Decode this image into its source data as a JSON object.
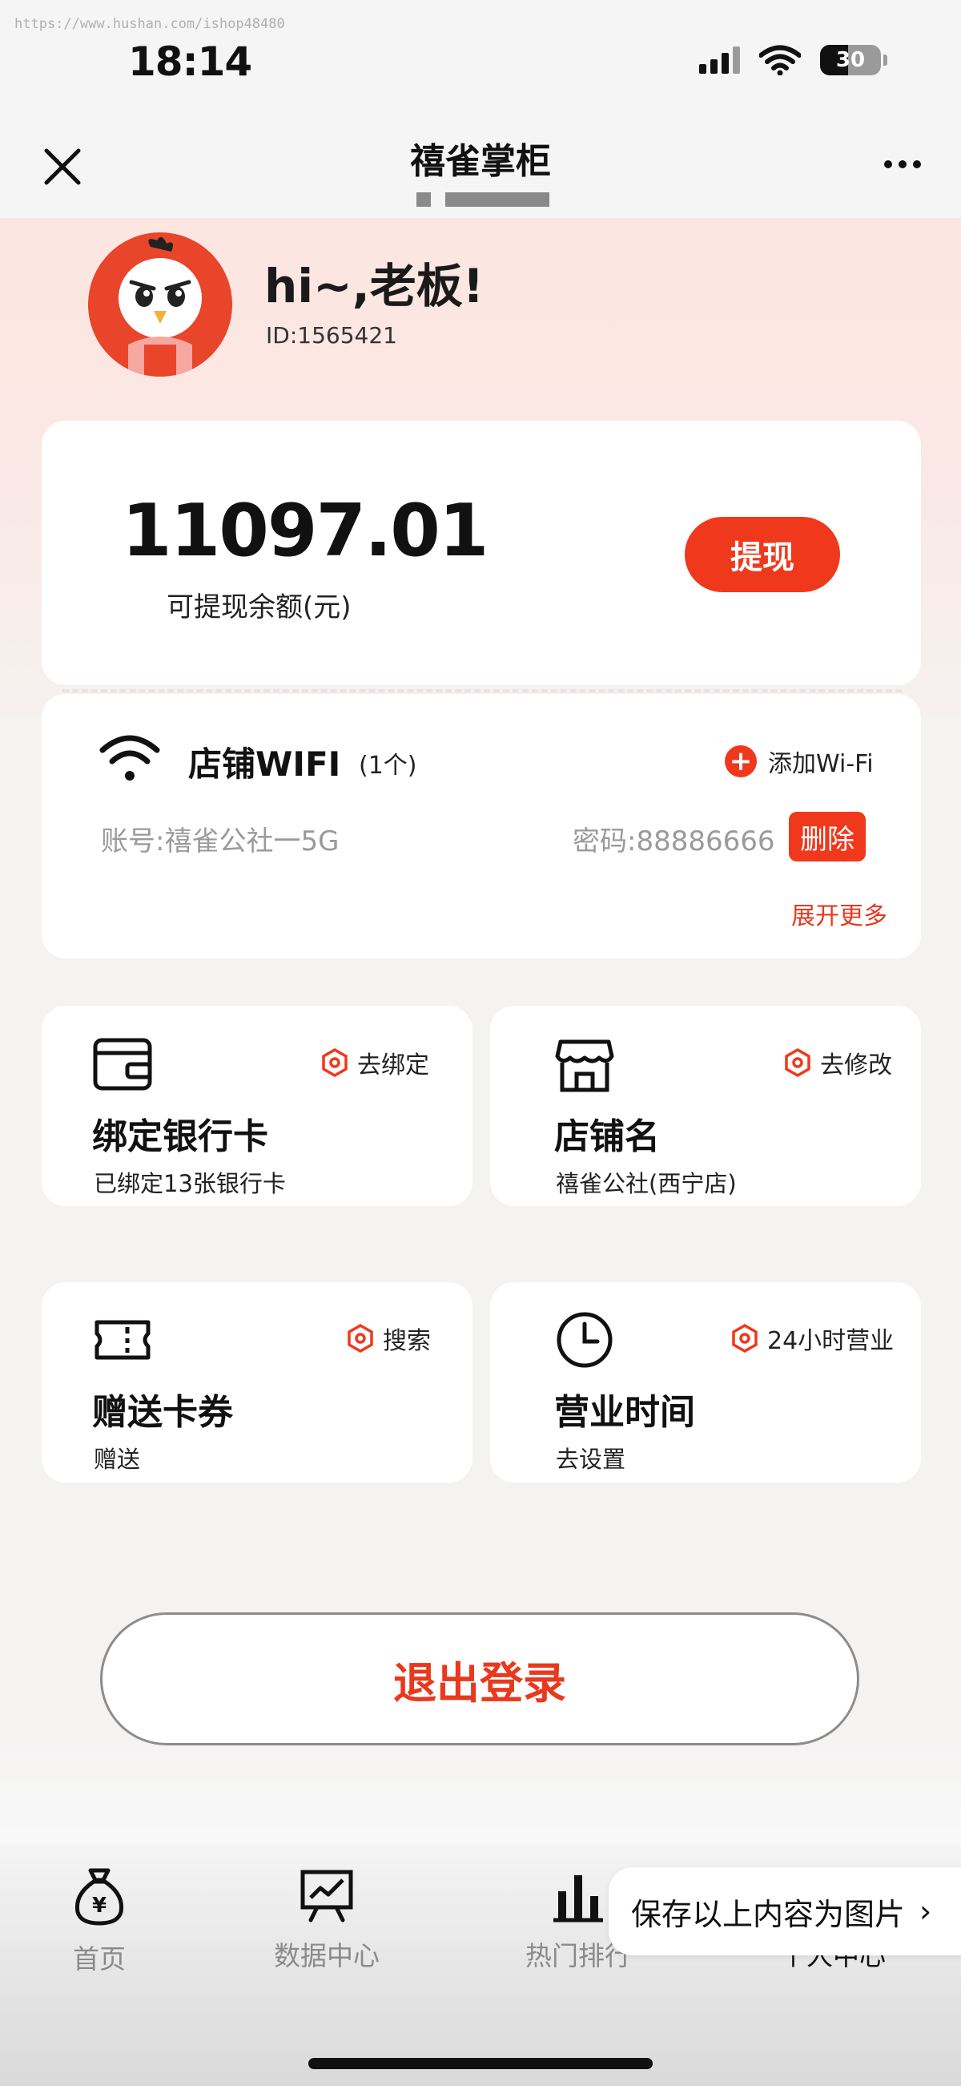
{
  "watermark": "https://www.hushan.com/ishop48480",
  "status_bar": {
    "time": "18:14",
    "battery": "30"
  },
  "nav": {
    "title": "禧雀掌柜"
  },
  "profile": {
    "greeting": "hi~,老板!",
    "id": "ID:1565421"
  },
  "balance": {
    "amount": "11097.01",
    "label": "可提现余额(元)",
    "withdraw_label": "提现"
  },
  "wifi": {
    "title": "店铺WIFI",
    "count": "(1个)",
    "add_label": "添加Wi-Fi",
    "account": "账号:禧雀公社一5G",
    "password": "密码:88886666",
    "delete_label": "删除",
    "expand_label": "展开更多"
  },
  "cards": [
    {
      "title": "绑定银行卡",
      "desc": "已绑定13张银行卡",
      "action": "去绑定",
      "icon": "wallet-icon"
    },
    {
      "title": "店铺名",
      "desc": "禧雀公社(西宁店)",
      "action": "去修改",
      "icon": "storefront-icon"
    },
    {
      "title": "赠送卡券",
      "desc": "赠送",
      "action": "搜索",
      "icon": "ticket-icon"
    },
    {
      "title": "营业时间",
      "desc": "去设置",
      "action": "24小时营业",
      "icon": "clock-icon"
    }
  ],
  "logout_label": "退出登录",
  "tabs": [
    {
      "label": "首页",
      "icon": "money-bag-icon"
    },
    {
      "label": "数据中心",
      "icon": "chart-board-icon"
    },
    {
      "label": "热门排行",
      "icon": "bar-chart-icon"
    },
    {
      "label": "个人中心",
      "icon": "person-icon"
    }
  ],
  "save_pill": "保存以上内容为图片",
  "colors": {
    "accent": "#f0381c",
    "background": "#f5f5f5",
    "card": "#ffffff"
  }
}
